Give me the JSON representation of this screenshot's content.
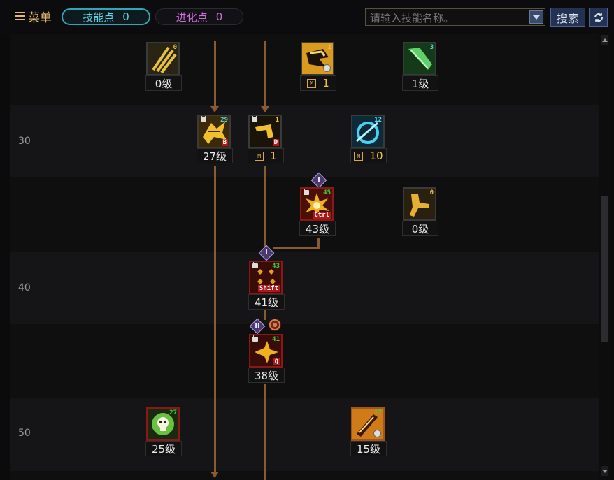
{
  "toolbar": {
    "menu_label": "菜单",
    "skill_points_label": "技能点",
    "skill_points_value": "0",
    "evo_points_label": "进化点",
    "evo_points_value": "0",
    "search_placeholder": "请输入技能名称。",
    "search_button": "搜索",
    "refresh_icon": "refresh-icon"
  },
  "level_rows": [
    "30",
    "40",
    "50"
  ],
  "skills": [
    {
      "id": "s1",
      "badge": "0",
      "level_text": "0级",
      "icon": "claw-slash-icon"
    },
    {
      "id": "s2",
      "badge": "1",
      "level_text": "1",
      "m": "M",
      "icon": "dash-strike-icon",
      "cooldown": true
    },
    {
      "id": "s3",
      "badge": "3",
      "level_text": "1级",
      "icon": "green-blade-icon"
    },
    {
      "id": "s4",
      "badge": "29",
      "level_text": "27级",
      "hotkey": "B",
      "icon": "dragon-roar-icon",
      "locked": true
    },
    {
      "id": "s5",
      "badge": "1",
      "level_text": "1",
      "m": "M",
      "hotkey": "D",
      "icon": "boomerang-icon",
      "locked": true
    },
    {
      "id": "s6",
      "badge": "12",
      "level_text": "10",
      "m": "M",
      "icon": "blue-crescent-icon"
    },
    {
      "id": "s7",
      "badge": "45",
      "level_text": "43级",
      "hotkey": "Ctrl",
      "icon": "explosion-icon",
      "locked": true
    },
    {
      "id": "s8",
      "badge": "0",
      "level_text": "0级",
      "icon": "kick-icon"
    },
    {
      "id": "s9",
      "badge": "43",
      "level_text": "41级",
      "hotkey": "Shift",
      "icon": "multi-strike-icon",
      "locked": true
    },
    {
      "id": "s10",
      "badge": "41",
      "level_text": "38级",
      "hotkey": "Q",
      "icon": "burst-icon",
      "locked": true
    },
    {
      "id": "s11",
      "badge": "27",
      "level_text": "25级",
      "icon": "skull-aura-icon"
    },
    {
      "id": "s12",
      "badge": "17",
      "level_text": "15级",
      "icon": "fire-blade-icon",
      "cooldown": true
    }
  ],
  "markers": {
    "tier1_a": "I",
    "tier1_b": "I",
    "tier2": "II"
  },
  "colors": {
    "accent_cyan": "#2fa7b8",
    "evo_purple": "#d36ee0",
    "connector": "#8a5a32",
    "badge_cyan": "#5fd6e8",
    "badge_green": "#3fd13f"
  }
}
